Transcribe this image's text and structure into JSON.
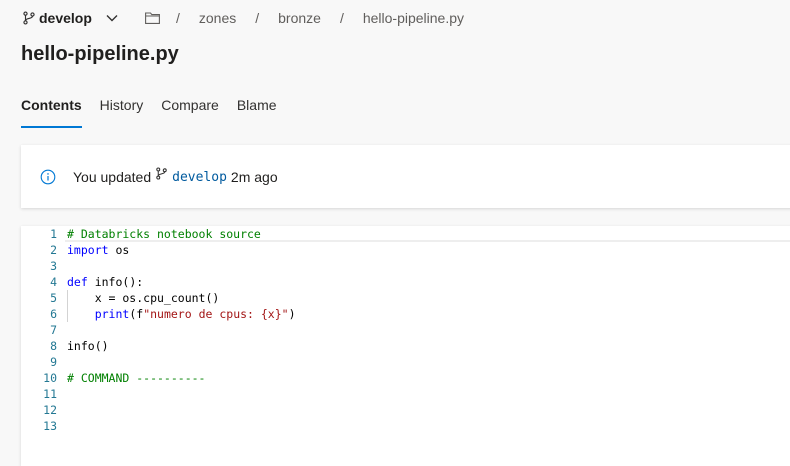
{
  "header": {
    "branch": "develop",
    "breadcrumb": [
      "zones",
      "bronze",
      "hello-pipeline.py"
    ],
    "separator": "/"
  },
  "file": {
    "title": "hello-pipeline.py"
  },
  "tabs": [
    {
      "label": "Contents",
      "active": true
    },
    {
      "label": "History",
      "active": false
    },
    {
      "label": "Compare",
      "active": false
    },
    {
      "label": "Blame",
      "active": false
    }
  ],
  "banner": {
    "prefix": "You updated",
    "branch": "develop",
    "suffix": "2m ago"
  },
  "code": {
    "line_numbers": [
      "1",
      "2",
      "3",
      "4",
      "5",
      "6",
      "7",
      "8",
      "9",
      "10",
      "11",
      "12",
      "13"
    ],
    "lines": [
      {
        "parts": [
          {
            "t": "# Databricks notebook source",
            "c": "cm"
          }
        ]
      },
      {
        "parts": [
          {
            "t": "import",
            "c": "kw"
          },
          {
            "t": " os",
            "c": ""
          }
        ]
      },
      {
        "parts": []
      },
      {
        "parts": [
          {
            "t": "def",
            "c": "kw"
          },
          {
            "t": " info():",
            "c": ""
          }
        ]
      },
      {
        "parts": [
          {
            "t": "    x = os.cpu_count()",
            "c": ""
          }
        ]
      },
      {
        "parts": [
          {
            "t": "    ",
            "c": ""
          },
          {
            "t": "print",
            "c": "kw"
          },
          {
            "t": "(f",
            "c": ""
          },
          {
            "t": "\"numero de cpus: {x}\"",
            "c": "str"
          },
          {
            "t": ")",
            "c": ""
          }
        ]
      },
      {
        "parts": []
      },
      {
        "parts": [
          {
            "t": "info()",
            "c": ""
          }
        ]
      },
      {
        "parts": []
      },
      {
        "parts": [
          {
            "t": "# COMMAND ----------",
            "c": "cm"
          }
        ]
      },
      {
        "parts": []
      },
      {
        "parts": []
      },
      {
        "parts": []
      }
    ]
  },
  "colors": {
    "accent": "#0078d4",
    "line_number": "#237893",
    "comment": "#008000",
    "keyword": "#0000ff",
    "string": "#a31515"
  }
}
